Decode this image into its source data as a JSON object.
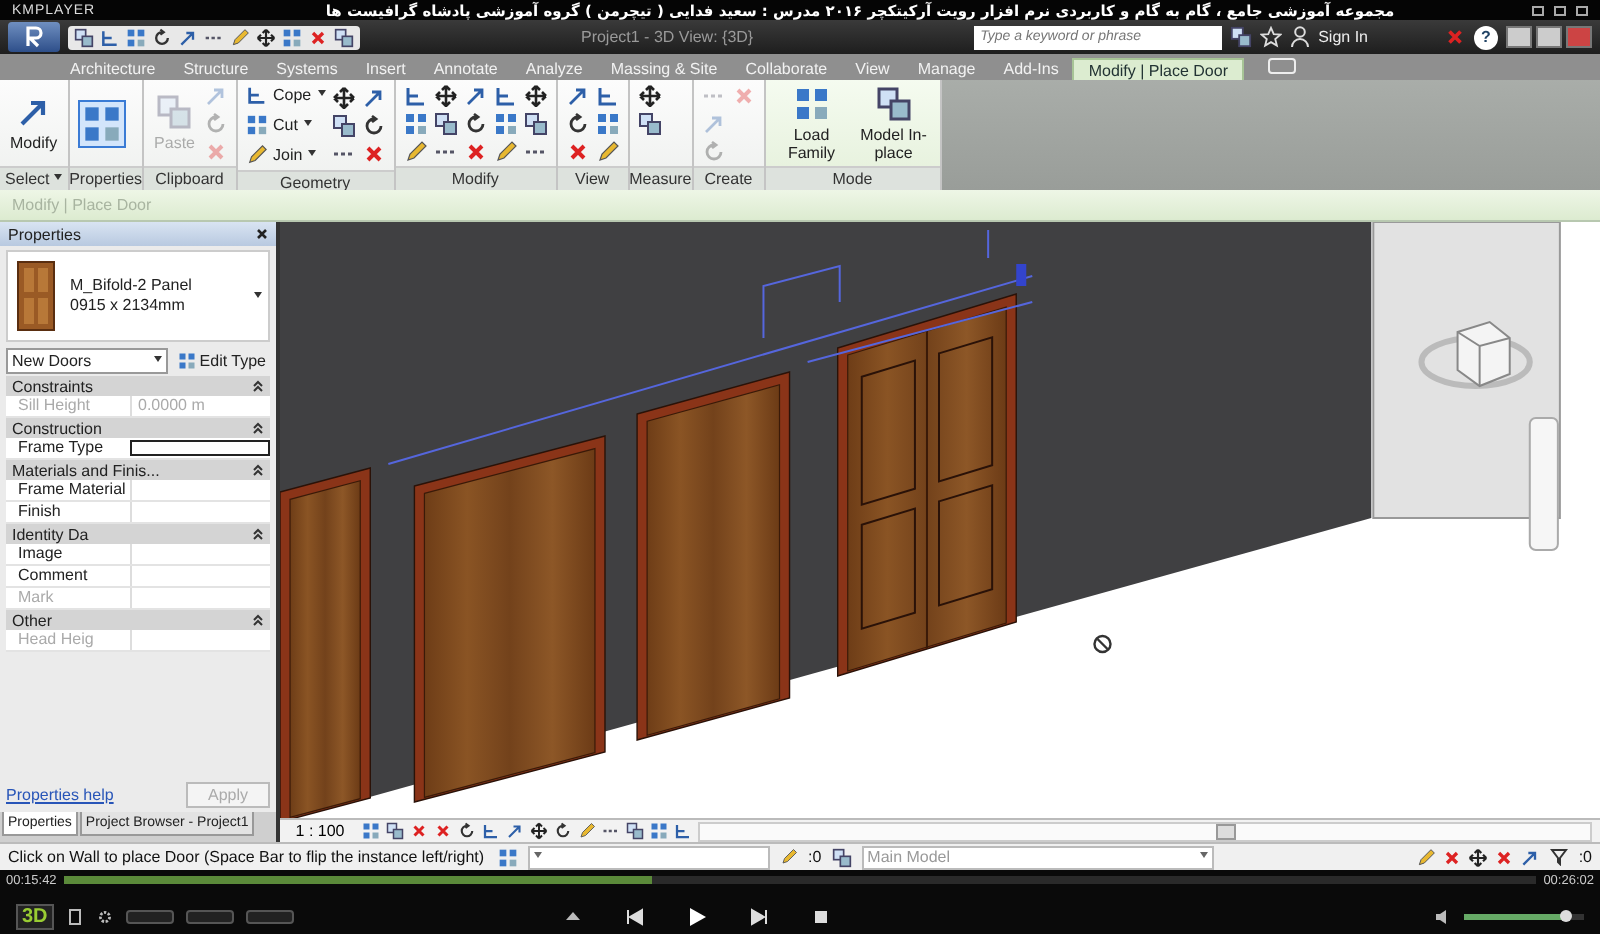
{
  "player": {
    "name": "KMPLAYER",
    "title": "مجموعه آموزشی جامع ، گام به گام و کاربردی نرم افزار رویت آرکیتکچر ۲۰۱۶   مدرس : سعید فدایی ( تیچرمن ) گروه آموزشی پادشاه گرافیست ها"
  },
  "app": {
    "title": "Project1 - 3D View: {3D}",
    "search": {
      "placeholder": "Type a keyword or phrase"
    },
    "sign_in": "Sign In",
    "help": "?"
  },
  "tabs": [
    {
      "label": "Architecture",
      "selected": false
    },
    {
      "label": "Structure",
      "selected": false
    },
    {
      "label": "Systems",
      "selected": false
    },
    {
      "label": "Insert",
      "selected": false
    },
    {
      "label": "Annotate",
      "selected": false
    },
    {
      "label": "Analyze",
      "selected": false
    },
    {
      "label": "Massing & Site",
      "selected": false
    },
    {
      "label": "Collaborate",
      "selected": false
    },
    {
      "label": "View",
      "selected": false
    },
    {
      "label": "Manage",
      "selected": false
    },
    {
      "label": "Add-Ins",
      "selected": false
    },
    {
      "label": "Modify | Place Door",
      "selected": true
    }
  ],
  "ribbon": {
    "panels": [
      {
        "label": "Select",
        "disabled": false,
        "tools": [
          {
            "kind": "large",
            "label": "Modify",
            "active": false
          }
        ]
      },
      {
        "label": "Properties",
        "disabled": false,
        "tools": [
          {
            "kind": "large",
            "active": true
          }
        ]
      },
      {
        "label": "Clipboard",
        "disabled": true,
        "tools": [
          {
            "kind": "large",
            "label": "Paste",
            "active": false
          },
          {
            "kind": "icon"
          },
          {
            "kind": "icon"
          },
          {
            "kind": "icon"
          }
        ]
      },
      {
        "label": "Geometry",
        "disabled": false,
        "tools": [
          {
            "kind": "small",
            "label": "Cope"
          },
          {
            "kind": "small",
            "label": "Cut"
          },
          {
            "kind": "small",
            "label": "Join"
          },
          {
            "kind": "icon"
          },
          {
            "kind": "icon"
          },
          {
            "kind": "icon"
          },
          {
            "kind": "icon"
          },
          {
            "kind": "icon"
          },
          {
            "kind": "icon"
          }
        ]
      },
      {
        "label": "Modify",
        "disabled": false,
        "tools": [
          {
            "kind": "icon"
          },
          {
            "kind": "icon"
          },
          {
            "kind": "icon"
          },
          {
            "kind": "icon"
          },
          {
            "kind": "icon"
          },
          {
            "kind": "icon"
          },
          {
            "kind": "icon"
          },
          {
            "kind": "icon"
          },
          {
            "kind": "icon"
          },
          {
            "kind": "icon"
          },
          {
            "kind": "icon"
          },
          {
            "kind": "icon"
          },
          {
            "kind": "icon"
          },
          {
            "kind": "icon"
          },
          {
            "kind": "icon"
          }
        ]
      },
      {
        "label": "View",
        "disabled": false,
        "tools": [
          {
            "kind": "icon"
          },
          {
            "kind": "icon"
          },
          {
            "kind": "icon"
          },
          {
            "kind": "icon"
          },
          {
            "kind": "icon"
          },
          {
            "kind": "icon"
          }
        ]
      },
      {
        "label": "Measure",
        "disabled": false,
        "tools": [
          {
            "kind": "icon"
          },
          {
            "kind": "icon"
          }
        ]
      },
      {
        "label": "Create",
        "disabled": true,
        "tools": [
          {
            "kind": "icon"
          },
          {
            "kind": "icon"
          },
          {
            "kind": "icon"
          },
          {
            "kind": "icon"
          }
        ]
      },
      {
        "label": "Mode",
        "disabled": false,
        "tools": [
          {
            "kind": "large",
            "label": "Load Family",
            "active": false
          },
          {
            "kind": "large",
            "label": "Model In-place",
            "active": false
          }
        ]
      }
    ]
  },
  "options_bar": {
    "label": "Modify | Place Door"
  },
  "properties": {
    "title": "Properties",
    "type_name": "M_Bifold-2 Panel",
    "type_size": "0915 x 2134mm",
    "instance_filter": "New Doors",
    "edit_type": "Edit Type",
    "groups": [
      {
        "name": "Constraints",
        "expanded": true,
        "rows": [
          {
            "label": "Sill Height",
            "value": "0.0000 m",
            "disabled": true,
            "editing": false
          }
        ]
      },
      {
        "name": "Construction",
        "expanded": true,
        "rows": [
          {
            "label": "Frame Type",
            "disabled": false,
            "editing": true
          }
        ]
      },
      {
        "name": "Materials and Finis...",
        "expanded": true,
        "rows": [
          {
            "label": "Frame Material",
            "disabled": false,
            "editing": false
          },
          {
            "label": "Finish",
            "disabled": false,
            "editing": false
          }
        ]
      },
      {
        "name": "Identity Da",
        "expanded": true,
        "rows": [
          {
            "label": "Image",
            "disabled": false,
            "editing": false
          },
          {
            "label": "Comment",
            "disabled": false,
            "editing": false
          },
          {
            "label": "Mark",
            "disabled": true,
            "editing": false
          }
        ]
      },
      {
        "name": "Other",
        "expanded": true,
        "rows": [
          {
            "label": "Head Heig",
            "disabled": true,
            "editing": false
          }
        ]
      }
    ],
    "help": "Properties help",
    "apply": {
      "label": "Apply",
      "disabled": true
    },
    "tabs": [
      {
        "label": "Properties",
        "selected": true
      },
      {
        "label": "Project Browser - Project1",
        "selected": false
      }
    ]
  },
  "view_bar": {
    "scale": "1 : 100"
  },
  "status_bar": {
    "message": "Click on Wall to place Door (Space Bar to flip the instance left/right)",
    "selection_count": ":0",
    "model": "Main Model",
    "filter_count": ":0"
  },
  "playback": {
    "elapsed": "00:15:42",
    "total": "00:26:02",
    "level": 0.4,
    "badge": "3D",
    "volume": {
      "level": 0.85
    }
  }
}
